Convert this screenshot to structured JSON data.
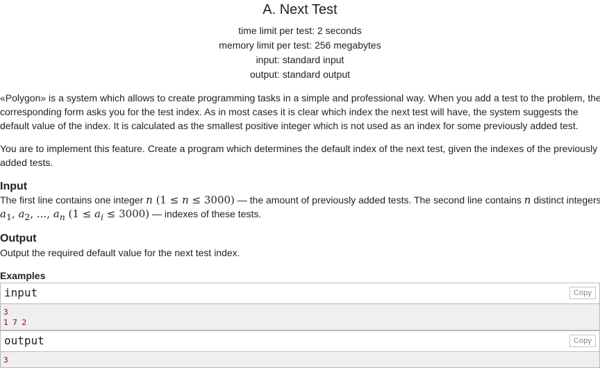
{
  "problem": {
    "title": "A. Next Test",
    "limits": [
      "time limit per test: 2 seconds",
      "memory limit per test: 256 megabytes",
      "input: standard input",
      "output: standard output"
    ],
    "statement": [
      "«Polygon» is a system which allows to create programming tasks in a simple and professional way. When you add a test to the problem, the corresponding form asks you for the test index. As in most cases it is clear which index the next test will have, the system suggests the default value of the index. It is calculated as the smallest positive integer which is not used as an index for some previously added test.",
      "You are to implement this feature. Create a program which determines the default index of the next test, given the indexes of the previously added tests."
    ],
    "input_section": {
      "title": "Input",
      "text_a": "The first line contains one integer ",
      "text_b": " — the amount of previously added tests. The second line contains ",
      "text_c": " distinct integers",
      "text_d": " — indexes of these tests."
    },
    "output_section": {
      "title": "Output",
      "text": "Output the required default value for the next test index."
    },
    "examples": {
      "title": "Examples",
      "input_label": "input",
      "output_label": "output",
      "copy_label": "Copy",
      "input_lines": [
        "3",
        "1 7 2"
      ],
      "output_lines": [
        "3"
      ]
    }
  }
}
